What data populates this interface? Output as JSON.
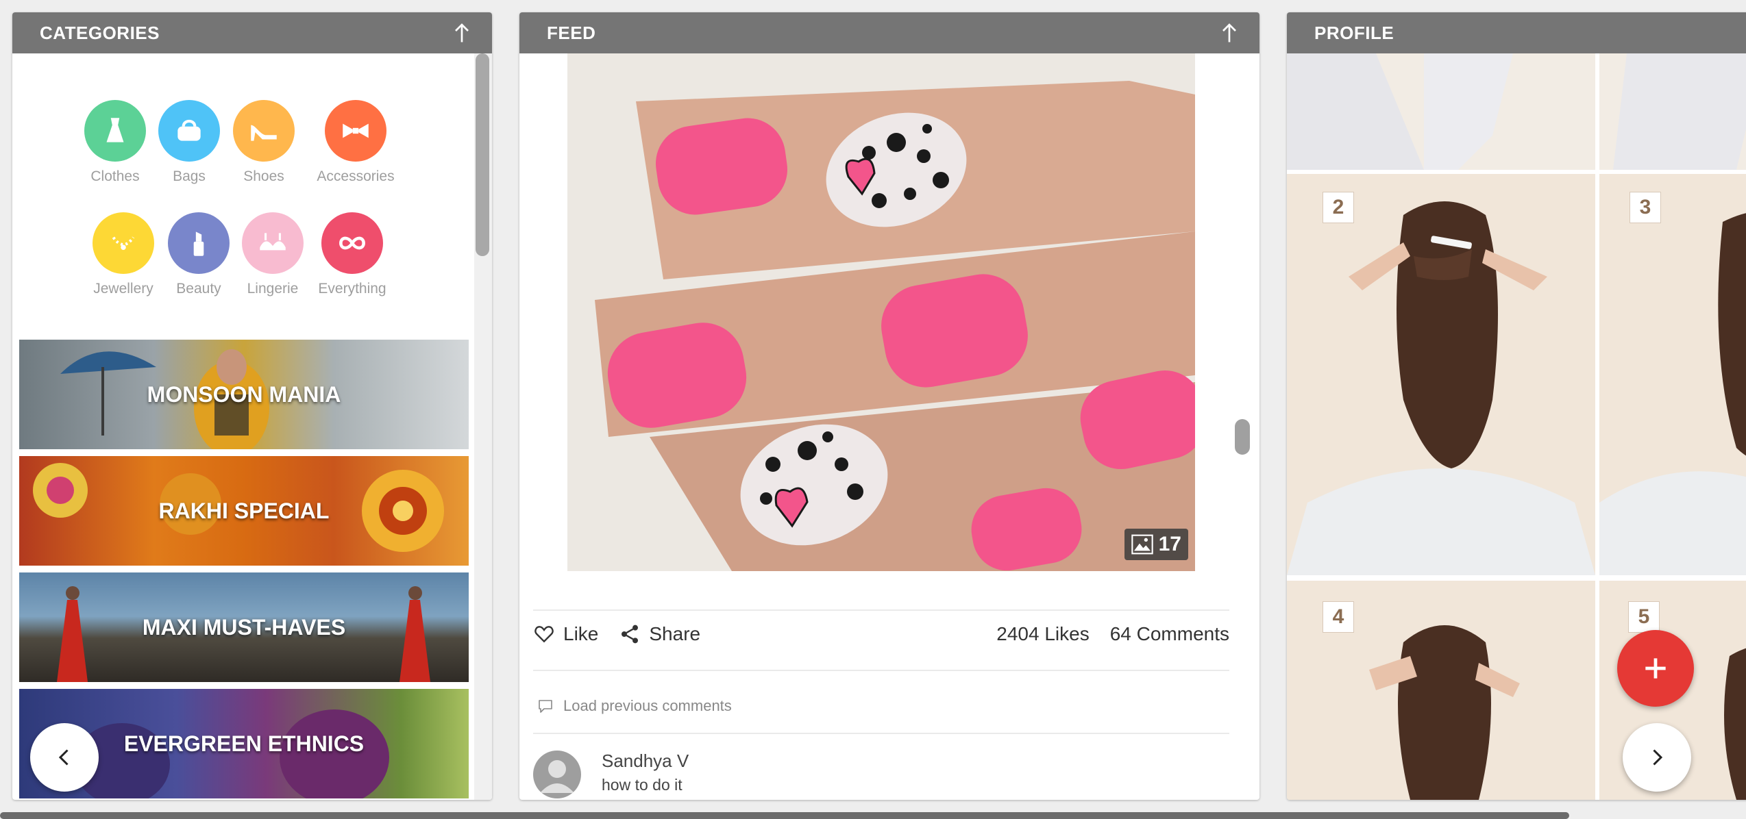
{
  "categories_panel": {
    "title": "CATEGORIES",
    "items": [
      {
        "label": "Clothes",
        "icon": "dress-icon",
        "color": "#5cd196"
      },
      {
        "label": "Bags",
        "icon": "handbag-icon",
        "color": "#4fc3f7"
      },
      {
        "label": "Shoes",
        "icon": "high-heel-icon",
        "color": "#ffb74d"
      },
      {
        "label": "Accessories",
        "icon": "bow-tie-icon",
        "color": "#ff7043"
      },
      {
        "label": "Jewellery",
        "icon": "necklace-icon",
        "color": "#fdd835"
      },
      {
        "label": "Beauty",
        "icon": "lipstick-icon",
        "color": "#7986cb"
      },
      {
        "label": "Lingerie",
        "icon": "bra-icon",
        "color": "#f8bbd0"
      },
      {
        "label": "Everything",
        "icon": "infinity-icon",
        "color": "#ef4e6c"
      }
    ],
    "banners": [
      {
        "label": "MONSOON MANIA"
      },
      {
        "label": "RAKHI SPECIAL"
      },
      {
        "label": "MAXI MUST-HAVES"
      },
      {
        "label": "EVERGREEN ETHNICS"
      }
    ]
  },
  "feed_panel": {
    "title": "FEED",
    "image_count": "17",
    "like_label": "Like",
    "share_label": "Share",
    "likes": "2404 Likes",
    "comments": "64 Comments",
    "load_previous": "Load previous comments",
    "comment": {
      "author": "Sandhya V",
      "text": "how to do it"
    }
  },
  "profile_panel": {
    "title": "PROFILE",
    "step_numbers": [
      "2",
      "3",
      "4",
      "5"
    ]
  },
  "colors": {
    "header_bg": "#757575",
    "fab_red": "#e53935",
    "nail_pink": "#f3558b"
  }
}
